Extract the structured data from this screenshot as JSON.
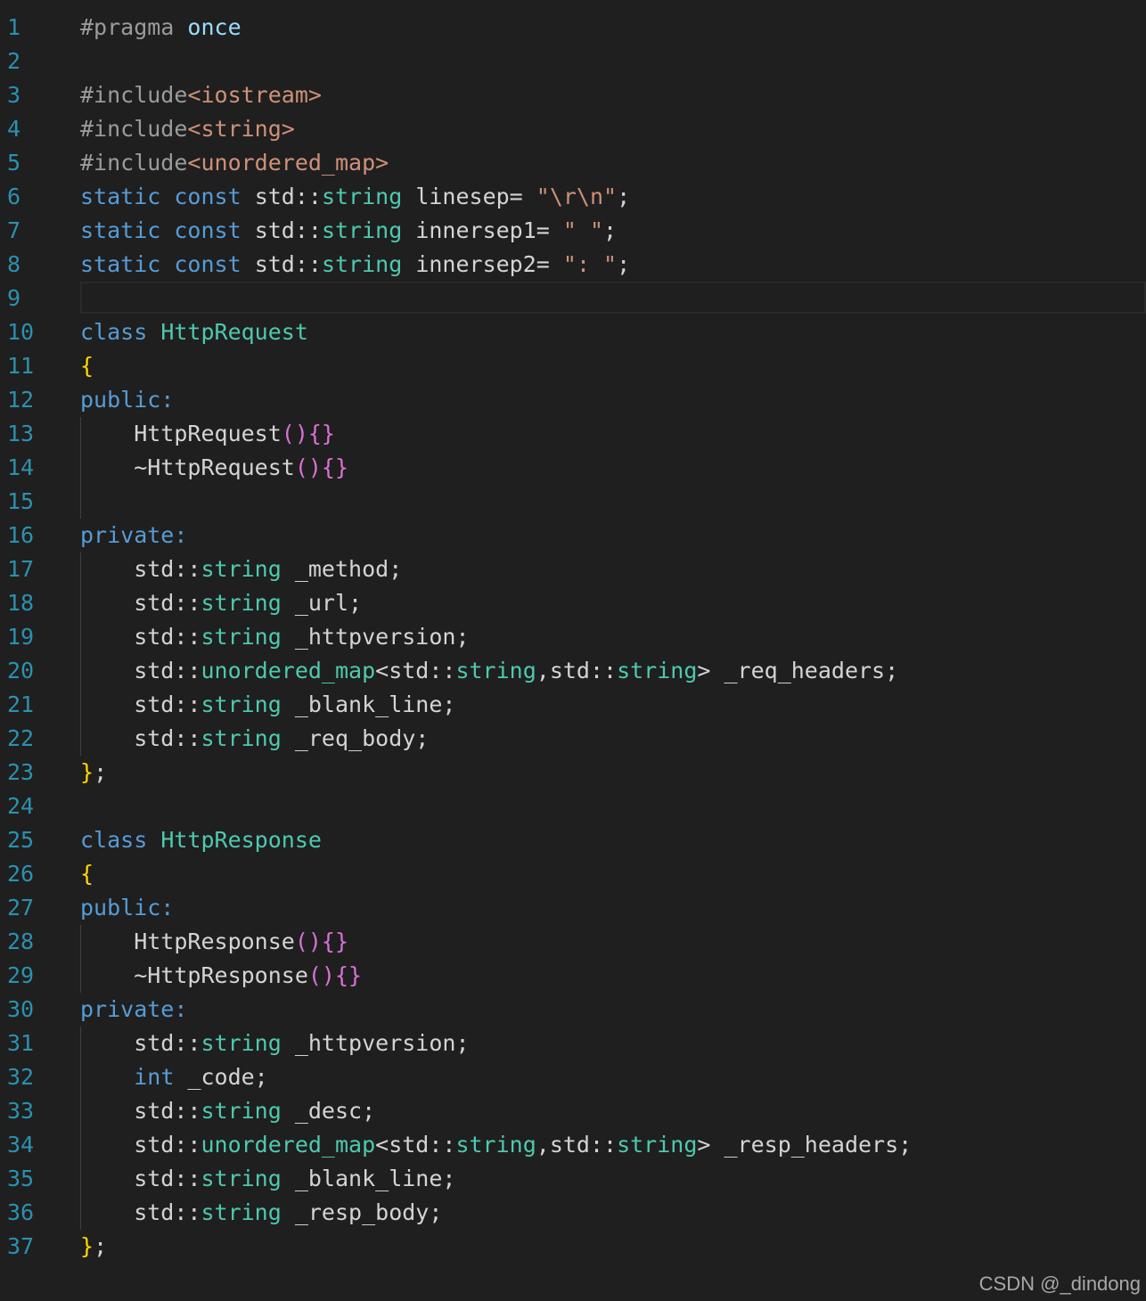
{
  "theme": {
    "background": "#1f1f1f",
    "line_number": "#2b91af",
    "default": "#d4d4d4",
    "keyword": "#569cd6",
    "type": "#4ec9b0",
    "string": "#ce9178",
    "bracket_yellow": "#ffd700",
    "bracket_pink": "#da70d6",
    "preproc": "#9b9b9b"
  },
  "watermark": "CSDN @_dindong",
  "lines": [
    {
      "n": "1",
      "indent": false,
      "tokens": [
        [
          "#pragma ",
          "preproc"
        ],
        [
          "once",
          "name"
        ]
      ]
    },
    {
      "n": "2",
      "indent": false,
      "tokens": []
    },
    {
      "n": "3",
      "indent": false,
      "tokens": [
        [
          "#include",
          "preproc"
        ],
        [
          "<iostream>",
          "string"
        ]
      ]
    },
    {
      "n": "4",
      "indent": false,
      "tokens": [
        [
          "#include",
          "preproc"
        ],
        [
          "<string>",
          "string"
        ]
      ]
    },
    {
      "n": "5",
      "indent": false,
      "tokens": [
        [
          "#include",
          "preproc"
        ],
        [
          "<unordered_map>",
          "string"
        ]
      ]
    },
    {
      "n": "6",
      "indent": false,
      "tokens": [
        [
          "static",
          "keyword"
        ],
        [
          " ",
          "default"
        ],
        [
          "const",
          "keyword"
        ],
        [
          " std::",
          "default"
        ],
        [
          "string",
          "type"
        ],
        [
          " linesep= ",
          "default"
        ],
        [
          "\"\\r\\n\"",
          "string"
        ],
        [
          ";",
          "default"
        ]
      ]
    },
    {
      "n": "7",
      "indent": false,
      "tokens": [
        [
          "static",
          "keyword"
        ],
        [
          " ",
          "default"
        ],
        [
          "const",
          "keyword"
        ],
        [
          " std::",
          "default"
        ],
        [
          "string",
          "type"
        ],
        [
          " innersep1= ",
          "default"
        ],
        [
          "\" \"",
          "string"
        ],
        [
          ";",
          "default"
        ]
      ]
    },
    {
      "n": "8",
      "indent": false,
      "tokens": [
        [
          "static",
          "keyword"
        ],
        [
          " ",
          "default"
        ],
        [
          "const",
          "keyword"
        ],
        [
          " std::",
          "default"
        ],
        [
          "string",
          "type"
        ],
        [
          " innersep2= ",
          "default"
        ],
        [
          "\": \"",
          "string"
        ],
        [
          ";",
          "default"
        ]
      ]
    },
    {
      "n": "9",
      "indent": false,
      "current": true,
      "tokens": []
    },
    {
      "n": "10",
      "indent": false,
      "tokens": [
        [
          "class",
          "keyword"
        ],
        [
          " ",
          "default"
        ],
        [
          "HttpRequest",
          "type"
        ]
      ]
    },
    {
      "n": "11",
      "indent": false,
      "tokens": [
        [
          "{",
          "bracket_yellow"
        ]
      ]
    },
    {
      "n": "12",
      "indent": false,
      "tokens": [
        [
          "public:",
          "keyword"
        ]
      ]
    },
    {
      "n": "13",
      "indent": true,
      "tokens": [
        [
          "    HttpRequest",
          "default"
        ],
        [
          "(){}",
          "bracket_pink"
        ]
      ]
    },
    {
      "n": "14",
      "indent": true,
      "tokens": [
        [
          "    ~HttpRequest",
          "default"
        ],
        [
          "(){}",
          "bracket_pink"
        ]
      ]
    },
    {
      "n": "15",
      "indent": true,
      "tokens": []
    },
    {
      "n": "16",
      "indent": false,
      "tokens": [
        [
          "private:",
          "keyword"
        ]
      ]
    },
    {
      "n": "17",
      "indent": true,
      "tokens": [
        [
          "    std::",
          "default"
        ],
        [
          "string",
          "type"
        ],
        [
          " _method;",
          "default"
        ]
      ]
    },
    {
      "n": "18",
      "indent": true,
      "tokens": [
        [
          "    std::",
          "default"
        ],
        [
          "string",
          "type"
        ],
        [
          " _url;",
          "default"
        ]
      ]
    },
    {
      "n": "19",
      "indent": true,
      "tokens": [
        [
          "    std::",
          "default"
        ],
        [
          "string",
          "type"
        ],
        [
          " _httpversion;",
          "default"
        ]
      ]
    },
    {
      "n": "20",
      "indent": true,
      "tokens": [
        [
          "    std::",
          "default"
        ],
        [
          "unordered_map",
          "type"
        ],
        [
          "<std::",
          "default"
        ],
        [
          "string",
          "type"
        ],
        [
          ",std::",
          "default"
        ],
        [
          "string",
          "type"
        ],
        [
          "> _req_headers;",
          "default"
        ]
      ]
    },
    {
      "n": "21",
      "indent": true,
      "tokens": [
        [
          "    std::",
          "default"
        ],
        [
          "string",
          "type"
        ],
        [
          " _blank_line;",
          "default"
        ]
      ]
    },
    {
      "n": "22",
      "indent": true,
      "tokens": [
        [
          "    std::",
          "default"
        ],
        [
          "string",
          "type"
        ],
        [
          " _req_body;",
          "default"
        ]
      ]
    },
    {
      "n": "23",
      "indent": false,
      "tokens": [
        [
          "}",
          "bracket_yellow"
        ],
        [
          ";",
          "default"
        ]
      ]
    },
    {
      "n": "24",
      "indent": false,
      "tokens": []
    },
    {
      "n": "25",
      "indent": false,
      "tokens": [
        [
          "class",
          "keyword"
        ],
        [
          " ",
          "default"
        ],
        [
          "HttpResponse",
          "type"
        ]
      ]
    },
    {
      "n": "26",
      "indent": false,
      "tokens": [
        [
          "{",
          "bracket_yellow"
        ]
      ]
    },
    {
      "n": "27",
      "indent": false,
      "tokens": [
        [
          "public:",
          "keyword"
        ]
      ]
    },
    {
      "n": "28",
      "indent": true,
      "tokens": [
        [
          "    HttpResponse",
          "default"
        ],
        [
          "(){}",
          "bracket_pink"
        ]
      ]
    },
    {
      "n": "29",
      "indent": true,
      "tokens": [
        [
          "    ~HttpResponse",
          "default"
        ],
        [
          "(){}",
          "bracket_pink"
        ]
      ]
    },
    {
      "n": "30",
      "indent": false,
      "tokens": [
        [
          "private:",
          "keyword"
        ]
      ]
    },
    {
      "n": "31",
      "indent": true,
      "tokens": [
        [
          "    std::",
          "default"
        ],
        [
          "string",
          "type"
        ],
        [
          " _httpversion;",
          "default"
        ]
      ]
    },
    {
      "n": "32",
      "indent": true,
      "tokens": [
        [
          "    ",
          "default"
        ],
        [
          "int",
          "keyword"
        ],
        [
          " _code;",
          "default"
        ]
      ]
    },
    {
      "n": "33",
      "indent": true,
      "tokens": [
        [
          "    std::",
          "default"
        ],
        [
          "string",
          "type"
        ],
        [
          " _desc;",
          "default"
        ]
      ]
    },
    {
      "n": "34",
      "indent": true,
      "tokens": [
        [
          "    std::",
          "default"
        ],
        [
          "unordered_map",
          "type"
        ],
        [
          "<std::",
          "default"
        ],
        [
          "string",
          "type"
        ],
        [
          ",std::",
          "default"
        ],
        [
          "string",
          "type"
        ],
        [
          "> _resp_headers;",
          "default"
        ]
      ]
    },
    {
      "n": "35",
      "indent": true,
      "tokens": [
        [
          "    std::",
          "default"
        ],
        [
          "string",
          "type"
        ],
        [
          " _blank_line;",
          "default"
        ]
      ]
    },
    {
      "n": "36",
      "indent": true,
      "tokens": [
        [
          "    std::",
          "default"
        ],
        [
          "string",
          "type"
        ],
        [
          " _resp_body;",
          "default"
        ]
      ]
    },
    {
      "n": "37",
      "indent": false,
      "tokens": [
        [
          "}",
          "bracket_yellow"
        ],
        [
          ";",
          "default"
        ]
      ]
    }
  ]
}
